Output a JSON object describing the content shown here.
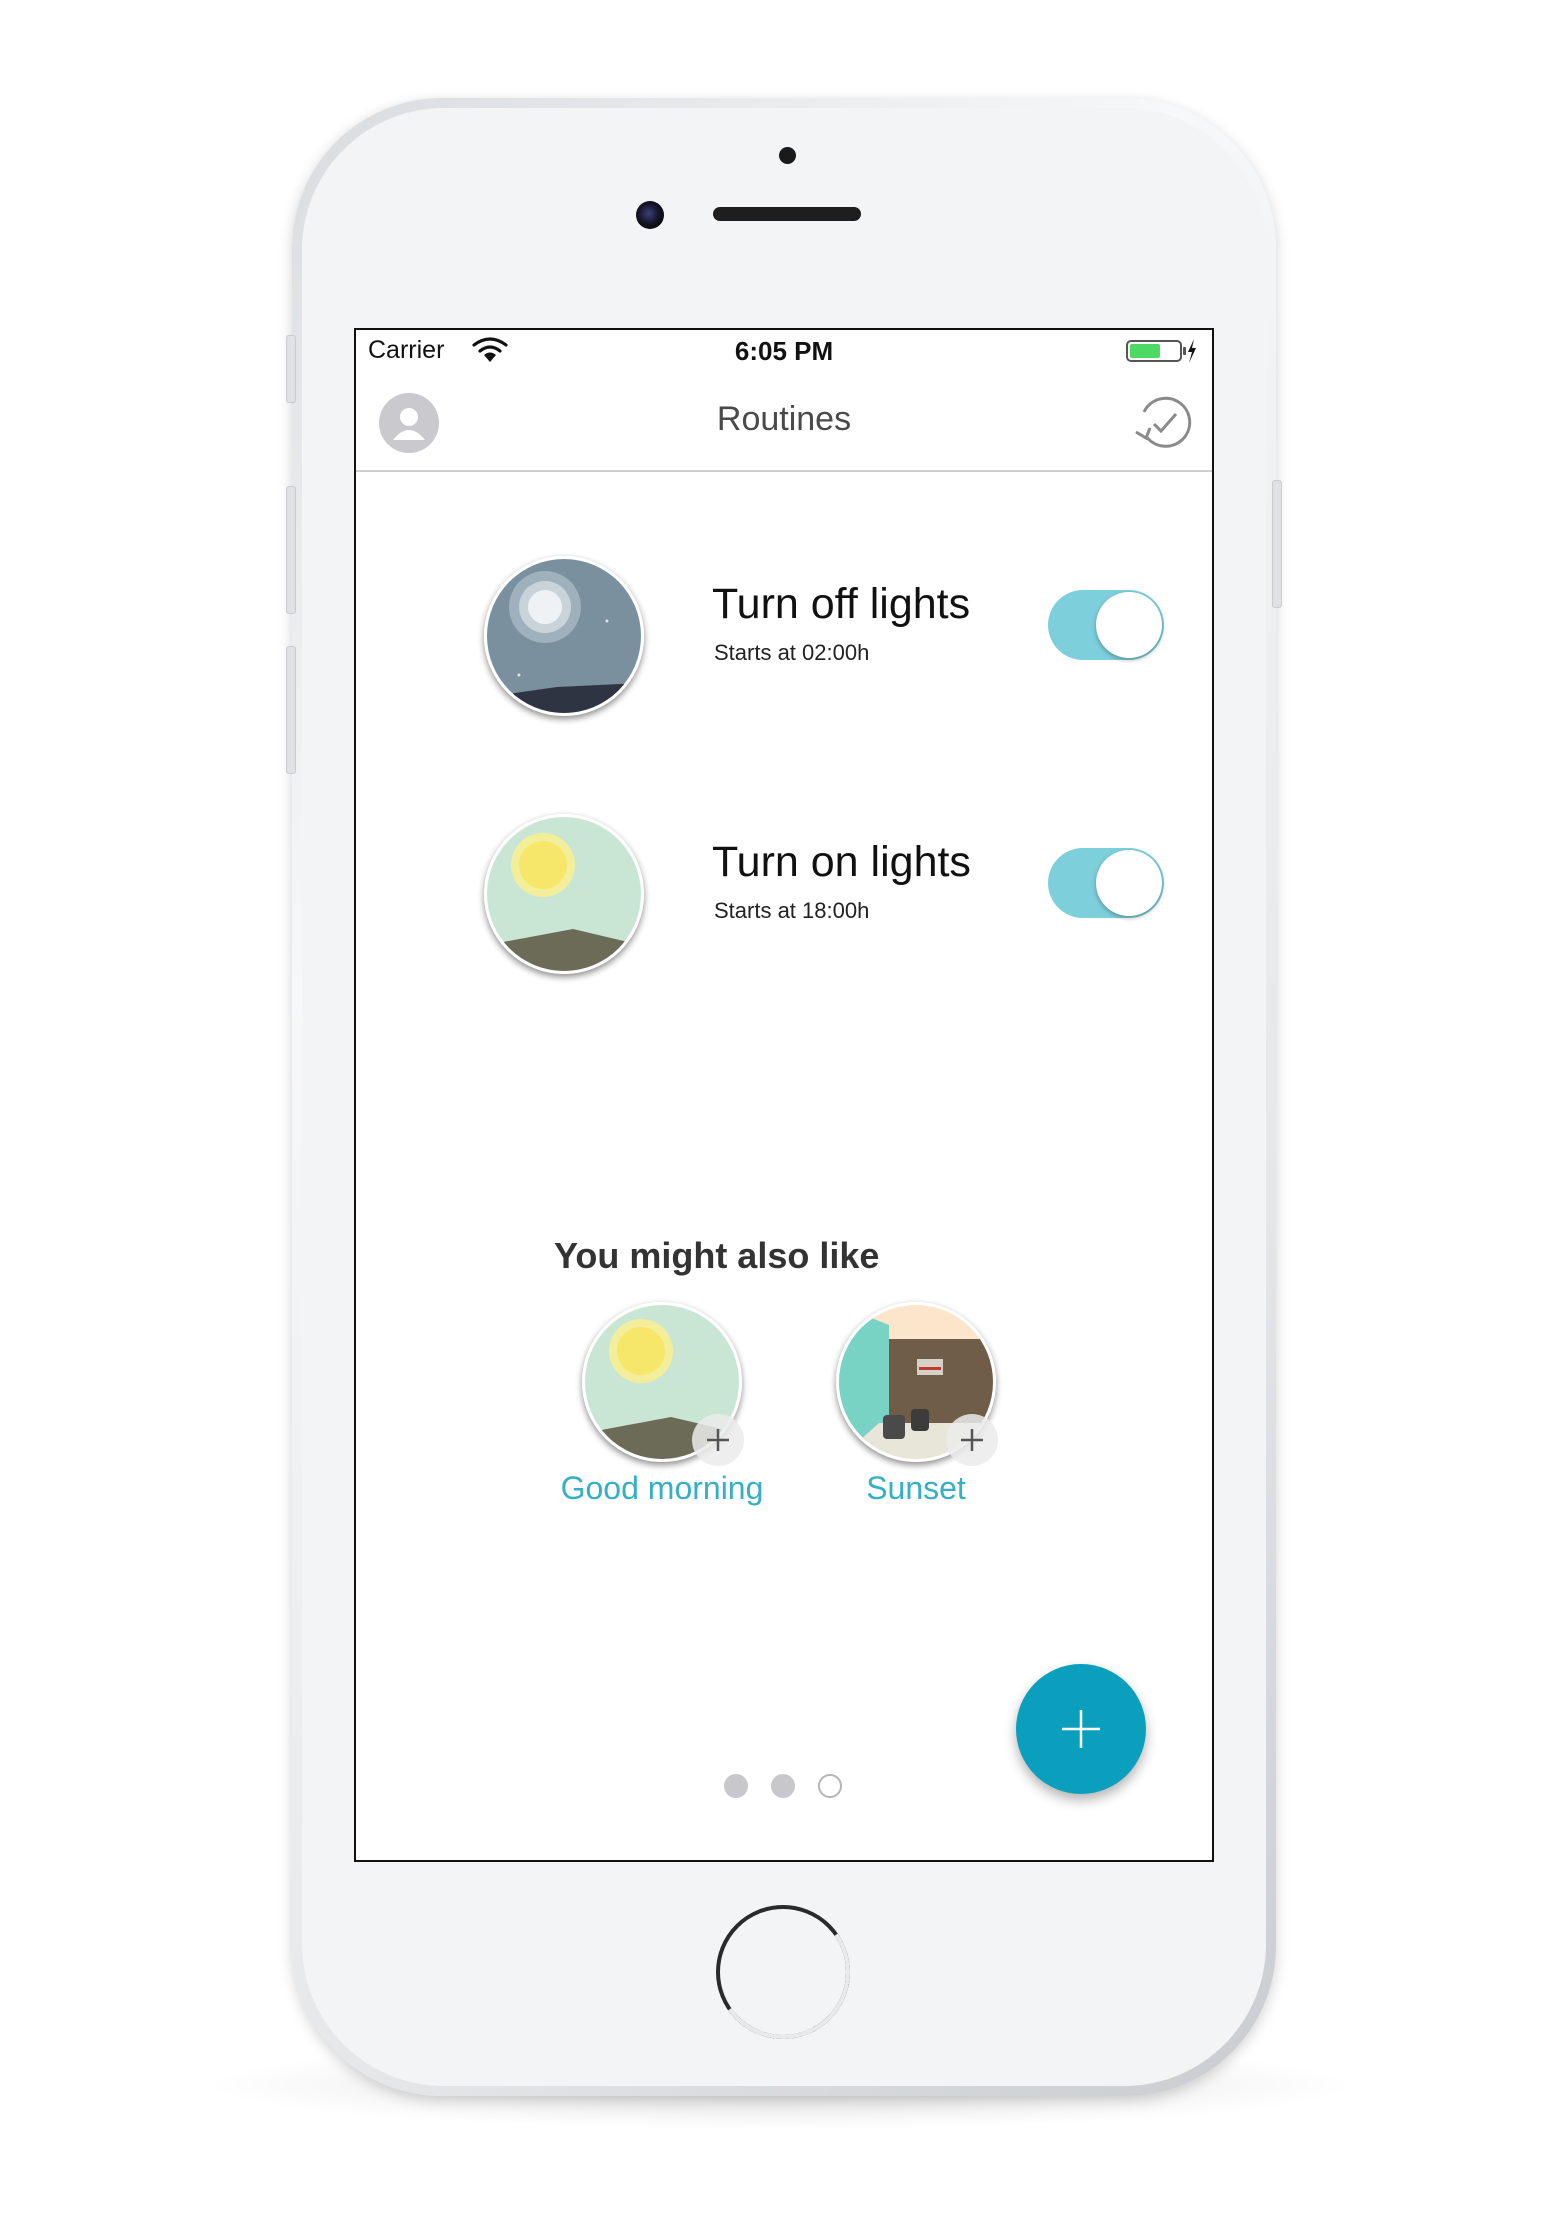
{
  "status_bar": {
    "carrier": "Carrier",
    "time": "6:05 PM"
  },
  "nav": {
    "title": "Routines",
    "left_icon": "avatar-icon",
    "right_icon": "history-icon"
  },
  "routines": [
    {
      "title": "Turn off lights",
      "subtitle": "Starts at 02:00h",
      "enabled": true,
      "thumb": "night-moon"
    },
    {
      "title": "Turn on lights",
      "subtitle": "Starts at 18:00h",
      "enabled": true,
      "thumb": "day-sun"
    }
  ],
  "suggestions": {
    "heading": "You might also like",
    "items": [
      {
        "label": "Good morning",
        "thumb": "day-sun"
      },
      {
        "label": "Sunset",
        "thumb": "room"
      }
    ]
  },
  "pager": {
    "count": 3,
    "current": 3
  },
  "colors": {
    "accent": "#0aa0bd",
    "toggle_on": "#7dcfdc",
    "link": "#34afc4"
  }
}
